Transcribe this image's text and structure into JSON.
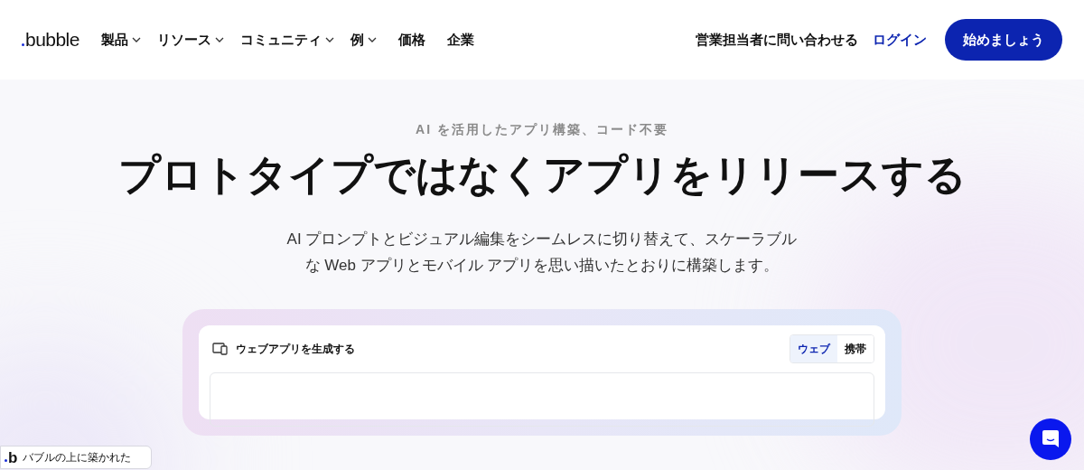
{
  "header": {
    "logo": "bubble",
    "nav": [
      {
        "label": "製品",
        "dropdown": true
      },
      {
        "label": "リソース",
        "dropdown": true
      },
      {
        "label": "コミュニティ",
        "dropdown": true
      },
      {
        "label": "例",
        "dropdown": true
      },
      {
        "label": "価格",
        "dropdown": false
      },
      {
        "label": "企業",
        "dropdown": false
      }
    ],
    "contact": "営業担当者に問い合わせる",
    "login": "ログイン",
    "cta": "始めましょう"
  },
  "hero": {
    "eyebrow": "AI を活用したアプリ構築、コード不要",
    "title": "プロトタイプではなくアプリをリリースする",
    "subtitle": "AI プロンプトとビジュアル編集をシームレスに切り替えて、スケーラブルな Web アプリとモバイル アプリを思い描いたとおりに構築します。"
  },
  "generator": {
    "title": "ウェブアプリを生成する",
    "tabs": [
      {
        "label": "ウェブ",
        "selected": true
      },
      {
        "label": "携帯",
        "selected": false
      }
    ]
  },
  "badge": {
    "mark": "b",
    "label": "バブルの上に築かれた"
  }
}
